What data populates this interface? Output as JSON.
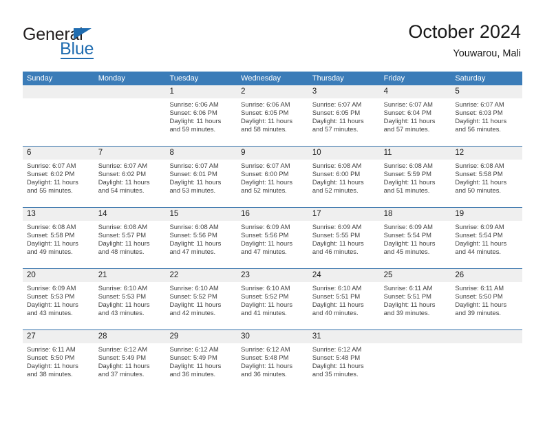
{
  "brand": {
    "name_top": "General",
    "name_bottom": "Blue",
    "accent_color": "#1f6cb0"
  },
  "header": {
    "title": "October 2024",
    "subtitle": "Youwarou, Mali"
  },
  "theme": {
    "header_bar": "#3b7cb8",
    "date_band": "#efefef",
    "separator": "#2f6ea8",
    "text": "#404040"
  },
  "calendar": {
    "weekdays": [
      "Sunday",
      "Monday",
      "Tuesday",
      "Wednesday",
      "Thursday",
      "Friday",
      "Saturday"
    ],
    "weeks": [
      [
        {
          "day": "",
          "sunrise": "",
          "sunset": "",
          "daylight1": "",
          "daylight2": ""
        },
        {
          "day": "",
          "sunrise": "",
          "sunset": "",
          "daylight1": "",
          "daylight2": ""
        },
        {
          "day": "1",
          "sunrise": "Sunrise: 6:06 AM",
          "sunset": "Sunset: 6:06 PM",
          "daylight1": "Daylight: 11 hours",
          "daylight2": "and 59 minutes."
        },
        {
          "day": "2",
          "sunrise": "Sunrise: 6:06 AM",
          "sunset": "Sunset: 6:05 PM",
          "daylight1": "Daylight: 11 hours",
          "daylight2": "and 58 minutes."
        },
        {
          "day": "3",
          "sunrise": "Sunrise: 6:07 AM",
          "sunset": "Sunset: 6:05 PM",
          "daylight1": "Daylight: 11 hours",
          "daylight2": "and 57 minutes."
        },
        {
          "day": "4",
          "sunrise": "Sunrise: 6:07 AM",
          "sunset": "Sunset: 6:04 PM",
          "daylight1": "Daylight: 11 hours",
          "daylight2": "and 57 minutes."
        },
        {
          "day": "5",
          "sunrise": "Sunrise: 6:07 AM",
          "sunset": "Sunset: 6:03 PM",
          "daylight1": "Daylight: 11 hours",
          "daylight2": "and 56 minutes."
        }
      ],
      [
        {
          "day": "6",
          "sunrise": "Sunrise: 6:07 AM",
          "sunset": "Sunset: 6:02 PM",
          "daylight1": "Daylight: 11 hours",
          "daylight2": "and 55 minutes."
        },
        {
          "day": "7",
          "sunrise": "Sunrise: 6:07 AM",
          "sunset": "Sunset: 6:02 PM",
          "daylight1": "Daylight: 11 hours",
          "daylight2": "and 54 minutes."
        },
        {
          "day": "8",
          "sunrise": "Sunrise: 6:07 AM",
          "sunset": "Sunset: 6:01 PM",
          "daylight1": "Daylight: 11 hours",
          "daylight2": "and 53 minutes."
        },
        {
          "day": "9",
          "sunrise": "Sunrise: 6:07 AM",
          "sunset": "Sunset: 6:00 PM",
          "daylight1": "Daylight: 11 hours",
          "daylight2": "and 52 minutes."
        },
        {
          "day": "10",
          "sunrise": "Sunrise: 6:08 AM",
          "sunset": "Sunset: 6:00 PM",
          "daylight1": "Daylight: 11 hours",
          "daylight2": "and 52 minutes."
        },
        {
          "day": "11",
          "sunrise": "Sunrise: 6:08 AM",
          "sunset": "Sunset: 5:59 PM",
          "daylight1": "Daylight: 11 hours",
          "daylight2": "and 51 minutes."
        },
        {
          "day": "12",
          "sunrise": "Sunrise: 6:08 AM",
          "sunset": "Sunset: 5:58 PM",
          "daylight1": "Daylight: 11 hours",
          "daylight2": "and 50 minutes."
        }
      ],
      [
        {
          "day": "13",
          "sunrise": "Sunrise: 6:08 AM",
          "sunset": "Sunset: 5:58 PM",
          "daylight1": "Daylight: 11 hours",
          "daylight2": "and 49 minutes."
        },
        {
          "day": "14",
          "sunrise": "Sunrise: 6:08 AM",
          "sunset": "Sunset: 5:57 PM",
          "daylight1": "Daylight: 11 hours",
          "daylight2": "and 48 minutes."
        },
        {
          "day": "15",
          "sunrise": "Sunrise: 6:08 AM",
          "sunset": "Sunset: 5:56 PM",
          "daylight1": "Daylight: 11 hours",
          "daylight2": "and 47 minutes."
        },
        {
          "day": "16",
          "sunrise": "Sunrise: 6:09 AM",
          "sunset": "Sunset: 5:56 PM",
          "daylight1": "Daylight: 11 hours",
          "daylight2": "and 47 minutes."
        },
        {
          "day": "17",
          "sunrise": "Sunrise: 6:09 AM",
          "sunset": "Sunset: 5:55 PM",
          "daylight1": "Daylight: 11 hours",
          "daylight2": "and 46 minutes."
        },
        {
          "day": "18",
          "sunrise": "Sunrise: 6:09 AM",
          "sunset": "Sunset: 5:54 PM",
          "daylight1": "Daylight: 11 hours",
          "daylight2": "and 45 minutes."
        },
        {
          "day": "19",
          "sunrise": "Sunrise: 6:09 AM",
          "sunset": "Sunset: 5:54 PM",
          "daylight1": "Daylight: 11 hours",
          "daylight2": "and 44 minutes."
        }
      ],
      [
        {
          "day": "20",
          "sunrise": "Sunrise: 6:09 AM",
          "sunset": "Sunset: 5:53 PM",
          "daylight1": "Daylight: 11 hours",
          "daylight2": "and 43 minutes."
        },
        {
          "day": "21",
          "sunrise": "Sunrise: 6:10 AM",
          "sunset": "Sunset: 5:53 PM",
          "daylight1": "Daylight: 11 hours",
          "daylight2": "and 43 minutes."
        },
        {
          "day": "22",
          "sunrise": "Sunrise: 6:10 AM",
          "sunset": "Sunset: 5:52 PM",
          "daylight1": "Daylight: 11 hours",
          "daylight2": "and 42 minutes."
        },
        {
          "day": "23",
          "sunrise": "Sunrise: 6:10 AM",
          "sunset": "Sunset: 5:52 PM",
          "daylight1": "Daylight: 11 hours",
          "daylight2": "and 41 minutes."
        },
        {
          "day": "24",
          "sunrise": "Sunrise: 6:10 AM",
          "sunset": "Sunset: 5:51 PM",
          "daylight1": "Daylight: 11 hours",
          "daylight2": "and 40 minutes."
        },
        {
          "day": "25",
          "sunrise": "Sunrise: 6:11 AM",
          "sunset": "Sunset: 5:51 PM",
          "daylight1": "Daylight: 11 hours",
          "daylight2": "and 39 minutes."
        },
        {
          "day": "26",
          "sunrise": "Sunrise: 6:11 AM",
          "sunset": "Sunset: 5:50 PM",
          "daylight1": "Daylight: 11 hours",
          "daylight2": "and 39 minutes."
        }
      ],
      [
        {
          "day": "27",
          "sunrise": "Sunrise: 6:11 AM",
          "sunset": "Sunset: 5:50 PM",
          "daylight1": "Daylight: 11 hours",
          "daylight2": "and 38 minutes."
        },
        {
          "day": "28",
          "sunrise": "Sunrise: 6:12 AM",
          "sunset": "Sunset: 5:49 PM",
          "daylight1": "Daylight: 11 hours",
          "daylight2": "and 37 minutes."
        },
        {
          "day": "29",
          "sunrise": "Sunrise: 6:12 AM",
          "sunset": "Sunset: 5:49 PM",
          "daylight1": "Daylight: 11 hours",
          "daylight2": "and 36 minutes."
        },
        {
          "day": "30",
          "sunrise": "Sunrise: 6:12 AM",
          "sunset": "Sunset: 5:48 PM",
          "daylight1": "Daylight: 11 hours",
          "daylight2": "and 36 minutes."
        },
        {
          "day": "31",
          "sunrise": "Sunrise: 6:12 AM",
          "sunset": "Sunset: 5:48 PM",
          "daylight1": "Daylight: 11 hours",
          "daylight2": "and 35 minutes."
        },
        {
          "day": "",
          "sunrise": "",
          "sunset": "",
          "daylight1": "",
          "daylight2": ""
        },
        {
          "day": "",
          "sunrise": "",
          "sunset": "",
          "daylight1": "",
          "daylight2": ""
        }
      ]
    ]
  }
}
